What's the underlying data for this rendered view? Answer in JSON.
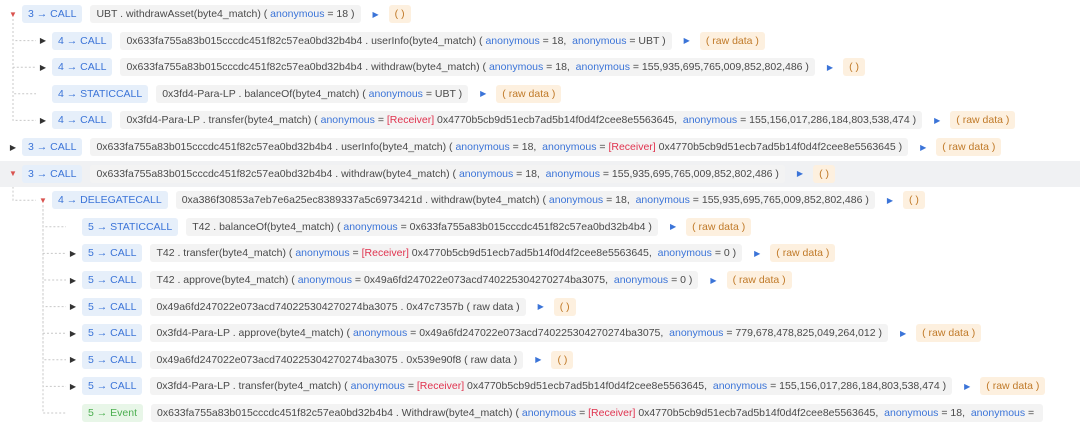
{
  "trace": {
    "rows": [
      {
        "depth": 0,
        "state": "open",
        "hl": false,
        "badge": "3 → CALL",
        "parts": [
          [
            "t",
            "UBT . withdrawAsset(byte4_match) ( "
          ],
          [
            "k",
            "anonymous"
          ],
          [
            "t",
            " = 18 )"
          ]
        ],
        "ret": "( )"
      },
      {
        "depth": 1,
        "state": "closed",
        "hl": false,
        "badge": "4 → CALL",
        "parts": [
          [
            "t",
            "0x633fa755a83b015cccdc451f82c57ea0bd32b4b4 . userInfo(byte4_match) ( "
          ],
          [
            "k",
            "anonymous"
          ],
          [
            "t",
            " = 18,  "
          ],
          [
            "k",
            "anonymous"
          ],
          [
            "t",
            " = UBT )"
          ]
        ],
        "ret": "( raw data )"
      },
      {
        "depth": 1,
        "state": "closed",
        "hl": false,
        "badge": "4 → CALL",
        "parts": [
          [
            "t",
            "0x633fa755a83b015cccdc451f82c57ea0bd32b4b4 . withdraw(byte4_match) ( "
          ],
          [
            "k",
            "anonymous"
          ],
          [
            "t",
            " = 18,  "
          ],
          [
            "k",
            "anonymous"
          ],
          [
            "t",
            " = 155,935,695,765,009,852,802,486 )"
          ]
        ],
        "ret": "( )"
      },
      {
        "depth": 1,
        "state": "none",
        "hl": false,
        "badge": "4 → STATICCALL",
        "parts": [
          [
            "t",
            "0x3fd4-Para-LP . balanceOf(byte4_match) ( "
          ],
          [
            "k",
            "anonymous"
          ],
          [
            "t",
            " = UBT )"
          ]
        ],
        "ret": "( raw data )"
      },
      {
        "depth": 1,
        "state": "closed",
        "hl": false,
        "badge": "4 → CALL",
        "parts": [
          [
            "t",
            "0x3fd4-Para-LP . transfer(byte4_match) ( "
          ],
          [
            "k",
            "anonymous"
          ],
          [
            "t",
            " = "
          ],
          [
            "r",
            "[Receiver]"
          ],
          [
            "t",
            " 0x4770b5cb9d51ecb7ad5b14f0d4f2cee8e5563645,  "
          ],
          [
            "k",
            "anonymous"
          ],
          [
            "t",
            " = 155,156,017,286,184,803,538,474 )"
          ]
        ],
        "ret": "( raw data )"
      },
      {
        "depth": 0,
        "state": "closed",
        "hl": false,
        "badge": "3 → CALL",
        "parts": [
          [
            "t",
            "0x633fa755a83b015cccdc451f82c57ea0bd32b4b4 . userInfo(byte4_match) ( "
          ],
          [
            "k",
            "anonymous"
          ],
          [
            "t",
            " = 18,  "
          ],
          [
            "k",
            "anonymous"
          ],
          [
            "t",
            " = "
          ],
          [
            "r",
            "[Receiver]"
          ],
          [
            "t",
            " 0x4770b5cb9d51ecb7ad5b14f0d4f2cee8e5563645 )"
          ]
        ],
        "ret": "( raw data )"
      },
      {
        "depth": 0,
        "state": "open",
        "hl": true,
        "badge": "3 → CALL",
        "parts": [
          [
            "t",
            "0x633fa755a83b015cccdc451f82c57ea0bd32b4b4 . withdraw(byte4_match) ( "
          ],
          [
            "k",
            "anonymous"
          ],
          [
            "t",
            " = 18,  "
          ],
          [
            "k",
            "anonymous"
          ],
          [
            "t",
            " = 155,935,695,765,009,852,802,486 )"
          ]
        ],
        "ret": "( )"
      },
      {
        "depth": 1,
        "state": "open",
        "hl": false,
        "badge": "4 → DELEGATECALL",
        "parts": [
          [
            "t",
            "0xa386f30853a7eb7e6a25ec8389337a5c6973421d . withdraw(byte4_match) ( "
          ],
          [
            "k",
            "anonymous"
          ],
          [
            "t",
            " = 18,  "
          ],
          [
            "k",
            "anonymous"
          ],
          [
            "t",
            " = 155,935,695,765,009,852,802,486 )"
          ]
        ],
        "ret": "( )"
      },
      {
        "depth": 2,
        "state": "none",
        "hl": false,
        "badge": "5 → STATICCALL",
        "parts": [
          [
            "t",
            "T42 . balanceOf(byte4_match) ( "
          ],
          [
            "k",
            "anonymous"
          ],
          [
            "t",
            " = 0x633fa755a83b015cccdc451f82c57ea0bd32b4b4 )"
          ]
        ],
        "ret": "( raw data )"
      },
      {
        "depth": 2,
        "state": "closed",
        "hl": false,
        "badge": "5 → CALL",
        "parts": [
          [
            "t",
            "T42 . transfer(byte4_match) ( "
          ],
          [
            "k",
            "anonymous"
          ],
          [
            "t",
            " = "
          ],
          [
            "r",
            "[Receiver]"
          ],
          [
            "t",
            " 0x4770b5cb9d51ecb7ad5b14f0d4f2cee8e5563645,  "
          ],
          [
            "k",
            "anonymous"
          ],
          [
            "t",
            " = 0 )"
          ]
        ],
        "ret": "( raw data )"
      },
      {
        "depth": 2,
        "state": "closed",
        "hl": false,
        "badge": "5 → CALL",
        "parts": [
          [
            "t",
            "T42 . approve(byte4_match) ( "
          ],
          [
            "k",
            "anonymous"
          ],
          [
            "t",
            " = 0x49a6fd247022e073acd740225304270274ba3075,  "
          ],
          [
            "k",
            "anonymous"
          ],
          [
            "t",
            " = 0 )"
          ]
        ],
        "ret": "( raw data )"
      },
      {
        "depth": 2,
        "state": "closed",
        "hl": false,
        "badge": "5 → CALL",
        "parts": [
          [
            "t",
            "0x49a6fd247022e073acd740225304270274ba3075 . 0x47c7357b ( raw data )"
          ]
        ],
        "ret": "( )"
      },
      {
        "depth": 2,
        "state": "closed",
        "hl": false,
        "badge": "5 → CALL",
        "parts": [
          [
            "t",
            "0x3fd4-Para-LP . approve(byte4_match) ( "
          ],
          [
            "k",
            "anonymous"
          ],
          [
            "t",
            " = 0x49a6fd247022e073acd740225304270274ba3075,  "
          ],
          [
            "k",
            "anonymous"
          ],
          [
            "t",
            " = 779,678,478,825,049,264,012 )"
          ]
        ],
        "ret": "( raw data )"
      },
      {
        "depth": 2,
        "state": "closed",
        "hl": false,
        "badge": "5 → CALL",
        "parts": [
          [
            "t",
            "0x49a6fd247022e073acd740225304270274ba3075 . 0x539e90f8 ( raw data )"
          ]
        ],
        "ret": "( )"
      },
      {
        "depth": 2,
        "state": "closed",
        "hl": false,
        "badge": "5 → CALL",
        "parts": [
          [
            "t",
            "0x3fd4-Para-LP . transfer(byte4_match) ( "
          ],
          [
            "k",
            "anonymous"
          ],
          [
            "t",
            " = "
          ],
          [
            "r",
            "[Receiver]"
          ],
          [
            "t",
            " 0x4770b5cb9d51ecb7ad5b14f0d4f2cee8e5563645,  "
          ],
          [
            "k",
            "anonymous"
          ],
          [
            "t",
            " = 155,156,017,286,184,803,538,474 )"
          ]
        ],
        "ret": "( raw data )"
      },
      {
        "depth": 2,
        "state": "none",
        "hl": false,
        "badge": "5 → Event",
        "event": true,
        "parts": [
          [
            "t",
            "0x633fa755a83b015cccdc451f82c57ea0bd32b4b4 . Withdraw(byte4_match) ( "
          ],
          [
            "k",
            "anonymous"
          ],
          [
            "t",
            " = "
          ],
          [
            "r",
            "[Receiver]"
          ],
          [
            "t",
            " 0x4770b5cb9d51ecb7ad5b14f0d4f2cee8e5563645,  "
          ],
          [
            "k",
            "anonymous"
          ],
          [
            "t",
            " = 18,  "
          ],
          [
            "k",
            "anonymous"
          ],
          [
            "t",
            " = "
          ]
        ],
        "ret": ""
      }
    ]
  },
  "icons": {
    "expanded": "caret-down-icon",
    "collapsed": "caret-right-icon",
    "output": "triangle-right-icon"
  },
  "colors": {
    "call_badge": "#3b74d8",
    "event_badge": "#4caf50",
    "receiver": "#e0334f",
    "return": "#c07a29",
    "toggle_open": "#d9534f"
  }
}
